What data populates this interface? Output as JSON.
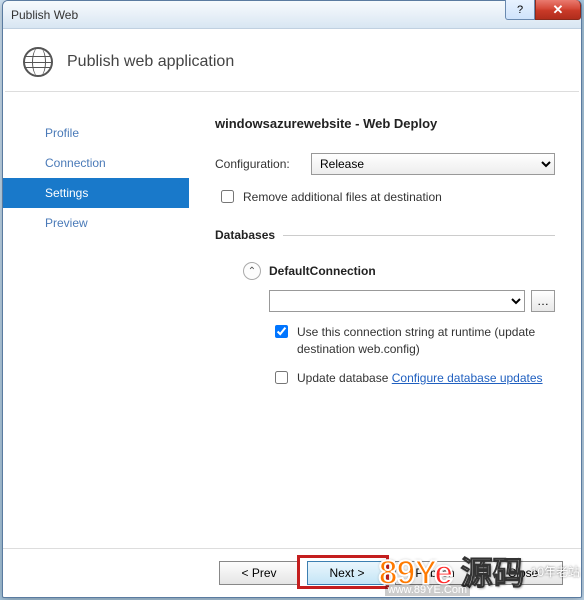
{
  "window": {
    "title": "Publish Web"
  },
  "header": {
    "title": "Publish web application"
  },
  "sidebar": {
    "items": [
      {
        "label": "Profile"
      },
      {
        "label": "Connection"
      },
      {
        "label": "Settings"
      },
      {
        "label": "Preview"
      }
    ]
  },
  "main": {
    "publish_title": "windowsazurewebsite - Web Deploy",
    "config_label": "Configuration:",
    "config_value": "Release",
    "remove_files_label": "Remove additional files at destination",
    "databases_section": "Databases",
    "default_conn_label": "DefaultConnection",
    "conn_value": "",
    "use_conn_label": "Use this connection string at runtime (update destination web.config)",
    "update_db_label": "Update database",
    "configure_link": "Configure database updates"
  },
  "footer": {
    "prev": "< Prev",
    "next": "Next >",
    "publish": "Publish",
    "close": "Close"
  },
  "watermark": {
    "brand": "89Ye",
    "chinese": "源码",
    "url": "www.89YE.Com",
    "tag": "10年老站"
  }
}
